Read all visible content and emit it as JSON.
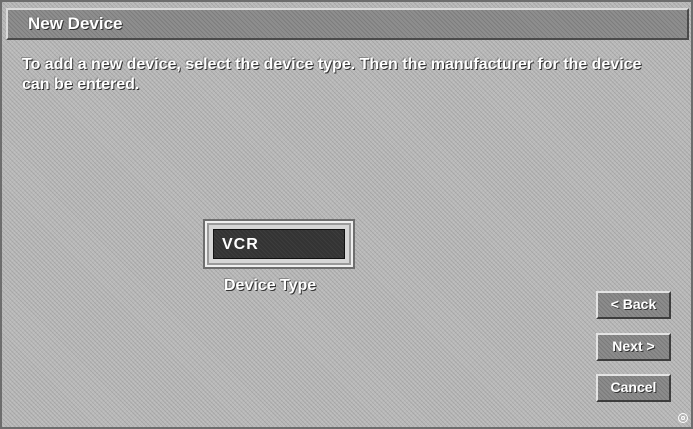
{
  "window": {
    "title": "New Device"
  },
  "instructions": {
    "text": "To add a new device, select the device type.  Then the manufacturer for the device can be entered."
  },
  "device_type": {
    "value": "VCR",
    "label": "Device Type"
  },
  "buttons": {
    "back": "< Back",
    "next": "Next >",
    "cancel": "Cancel"
  },
  "colors": {
    "background": "#b9b9b9",
    "title_bar": "#8e8e8e",
    "field_fill": "#333333",
    "text": "#ffffff"
  },
  "icons": {
    "corner_mark": "registered-mark-icon"
  }
}
